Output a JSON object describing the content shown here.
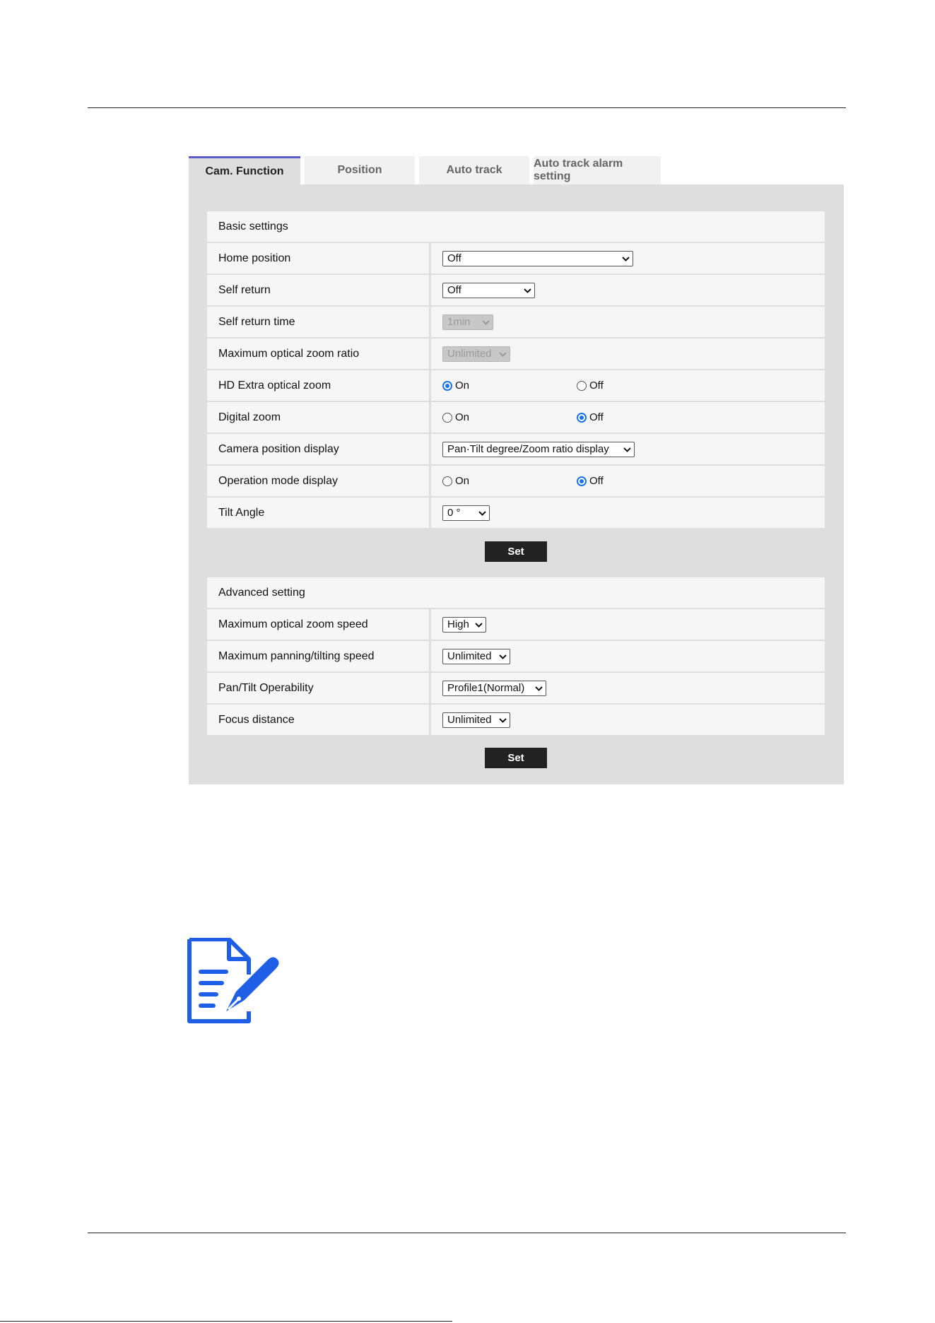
{
  "tabs": [
    {
      "label": "Cam. Function",
      "active": true
    },
    {
      "label": "Position",
      "active": false
    },
    {
      "label": "Auto track",
      "active": false
    },
    {
      "label": "Auto track alarm setting",
      "active": false
    }
  ],
  "basic": {
    "header": "Basic settings",
    "home_position": {
      "label": "Home position",
      "value": "Off"
    },
    "self_return": {
      "label": "Self return",
      "value": "Off"
    },
    "self_return_time": {
      "label": "Self return time",
      "value": "1min",
      "disabled": true
    },
    "max_optical_zoom_ratio": {
      "label": "Maximum optical zoom ratio",
      "value": "Unlimited",
      "disabled": true
    },
    "hd_extra_optical_zoom": {
      "label": "HD Extra optical zoom",
      "on_label": "On",
      "off_label": "Off",
      "selected": "On"
    },
    "digital_zoom": {
      "label": "Digital zoom",
      "on_label": "On",
      "off_label": "Off",
      "selected": "Off"
    },
    "camera_position_display": {
      "label": "Camera position display",
      "value": "Pan·Tilt degree/Zoom ratio display"
    },
    "operation_mode_display": {
      "label": "Operation mode display",
      "on_label": "On",
      "off_label": "Off",
      "selected": "Off"
    },
    "tilt_angle": {
      "label": "Tilt Angle",
      "value": "0 °"
    },
    "set_label": "Set"
  },
  "advanced": {
    "header": "Advanced setting",
    "max_optical_zoom_speed": {
      "label": "Maximum optical zoom speed",
      "value": "High"
    },
    "max_pan_tilt_speed": {
      "label": "Maximum panning/tilting speed",
      "value": "Unlimited"
    },
    "pan_tilt_operability": {
      "label": "Pan/Tilt Operability",
      "value": "Profile1(Normal)"
    },
    "focus_distance": {
      "label": "Focus distance",
      "value": "Unlimited"
    },
    "set_label": "Set"
  },
  "note_icon": {
    "name": "note-edit-icon",
    "color": "#1f5fe8"
  },
  "colors": {
    "accent": "#1a73e8",
    "tab_indicator": "#5a5ac8",
    "button": "#222222",
    "panel": "#dedede"
  }
}
